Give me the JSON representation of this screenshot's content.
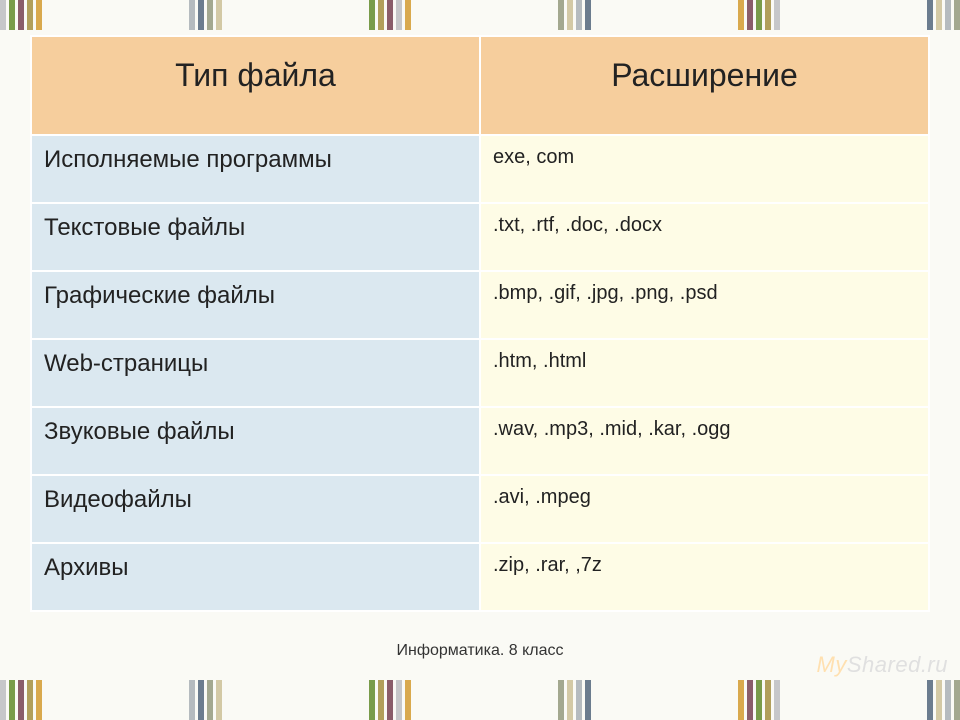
{
  "table": {
    "headers": {
      "type": "Тип файла",
      "ext": "Расширение"
    },
    "rows": [
      {
        "type": "Исполняемые программы",
        "ext": "exe, com"
      },
      {
        "type": "Текстовые файлы",
        "ext": ".txt, .rtf, .doc, .docx"
      },
      {
        "type": "Графические файлы",
        "ext": ".bmp, .gif, .jpg, .png, .psd"
      },
      {
        "type": "Web-страницы",
        "ext": ".htm, .html"
      },
      {
        "type": "Звуковые файлы",
        "ext": ".wav, .mp3, .mid, .kar, .ogg"
      },
      {
        "type": "Видеофайлы",
        "ext": ".avi, .mpeg"
      },
      {
        "type": "Архивы",
        "ext": ".zip, .rar, ,7z"
      }
    ]
  },
  "footer": "Информатика. 8 класс",
  "watermark": {
    "part1": "My",
    "part2": "Shared.ru"
  }
}
